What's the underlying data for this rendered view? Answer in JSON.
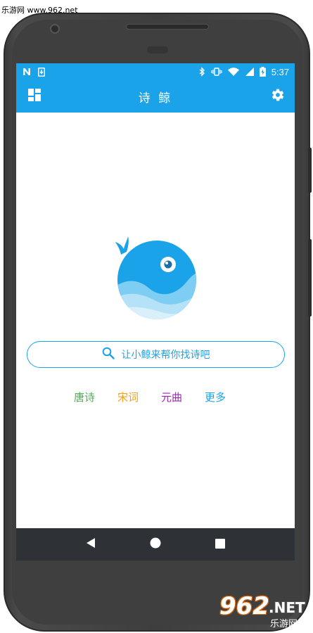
{
  "watermark": {
    "text": "乐游网 www.962.net"
  },
  "status_bar": {
    "time": "5:37",
    "icons": [
      "notification-n-icon",
      "sim-download-icon",
      "bluetooth-icon",
      "vibrate-icon",
      "wifi-icon",
      "signal-icon",
      "battery-charging-icon"
    ]
  },
  "app_bar": {
    "title": "诗 鲸",
    "left_icon": "dashboard-icon",
    "right_icon": "settings-gear-icon"
  },
  "logo": {
    "icon": "whale-logo-icon",
    "primary_color": "#1aa3e8"
  },
  "search": {
    "placeholder": "让小鲸来帮你找诗吧",
    "icon": "search-icon"
  },
  "categories": [
    {
      "label": "唐诗",
      "color": "#4caf50"
    },
    {
      "label": "宋词",
      "color": "#f0a01e"
    },
    {
      "label": "元曲",
      "color": "#9c27b0"
    },
    {
      "label": "更多",
      "color": "#1aa3e8"
    }
  ],
  "nav_bar": {
    "icons": [
      "back-icon",
      "home-icon",
      "recents-icon"
    ]
  },
  "brand": {
    "number": "962",
    "suffix": ".NET",
    "cn": "乐游网"
  },
  "colors": {
    "accent": "#1aa3e8",
    "nav_bg": "#2e3136",
    "phone_body": "#3f3f3f"
  }
}
